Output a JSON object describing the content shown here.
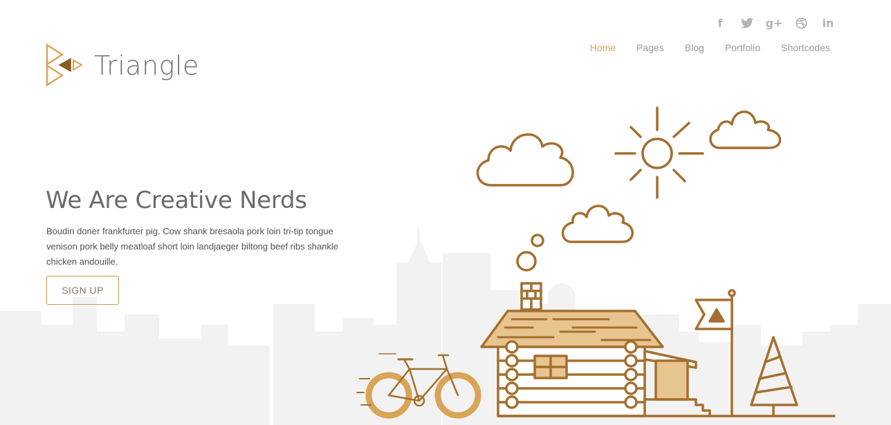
{
  "brand": {
    "name": "Triangle",
    "logo_icon": "triangle-logo-icon",
    "accent": "#d8a457",
    "line_color": "#a46f2e"
  },
  "social": [
    {
      "name": "facebook-icon",
      "glyph": "f"
    },
    {
      "name": "twitter-icon",
      "glyph": "🐦"
    },
    {
      "name": "google-plus-icon",
      "glyph": "g+"
    },
    {
      "name": "dribbble-icon",
      "glyph": "◍"
    },
    {
      "name": "linkedin-icon",
      "glyph": "in"
    }
  ],
  "nav": {
    "items": [
      {
        "label": "Home",
        "active": true
      },
      {
        "label": "Pages",
        "active": false
      },
      {
        "label": "Blog",
        "active": false
      },
      {
        "label": "Portfolio",
        "active": false
      },
      {
        "label": "Shortcodes",
        "active": false
      }
    ]
  },
  "hero": {
    "title": "We Are Creative Nerds",
    "text": "Boudin doner frankfurter pig. Cow shank bresaola pork loin tri-tip tongue venison pork belly meatloaf short loin landjaeger biltong beef ribs shankle chicken andouille.",
    "cta_label": "SIGN UP"
  }
}
